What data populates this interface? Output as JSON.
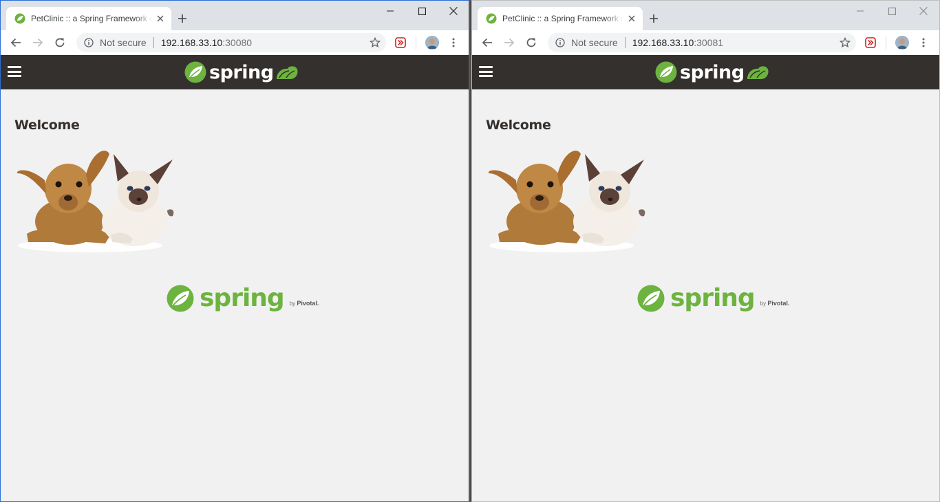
{
  "windows": [
    {
      "tab": {
        "title": "PetClinic :: a Spring Framework demonstration"
      },
      "omnibox": {
        "security": "Not secure",
        "host": "192.168.33.10",
        "port": ":30080"
      },
      "header": {
        "brand": "spring"
      },
      "page": {
        "heading": "Welcome"
      },
      "footer": {
        "brand": "spring",
        "by": "by",
        "company": "Pivotal."
      }
    },
    {
      "tab": {
        "title": "PetClinic :: a Spring Framework demonstration"
      },
      "omnibox": {
        "security": "Not secure",
        "host": "192.168.33.10",
        "port": ":30081"
      },
      "header": {
        "brand": "spring"
      },
      "page": {
        "heading": "Welcome"
      },
      "footer": {
        "brand": "spring",
        "by": "by",
        "company": "Pivotal."
      }
    }
  ],
  "colors": {
    "spring_green": "#6db33f",
    "header_bg": "#34302d",
    "page_bg": "#f1f1f1",
    "tabstrip_bg": "#dee1e6"
  },
  "icons": [
    "favicon-spring-icon",
    "close-icon",
    "plus-icon",
    "minimize-icon",
    "maximize-icon",
    "back-icon",
    "forward-icon",
    "reload-icon",
    "info-icon",
    "star-icon",
    "extension-icon",
    "avatar",
    "menu-dots-icon",
    "hamburger-icon",
    "spring-leaf-icon"
  ]
}
